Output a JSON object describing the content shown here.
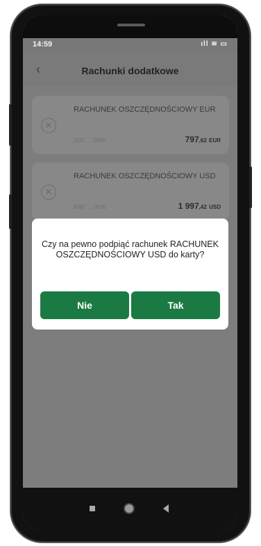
{
  "status_bar": {
    "time": "14:59",
    "icons": "ıll ≋ ▭"
  },
  "header": {
    "title": "Rachunki dodatkowe"
  },
  "accounts": [
    {
      "name": "RACHUNEK OSZCZĘDNOŚCIOWY EUR",
      "number": "1187 ... 0050",
      "amount": "797",
      "amount_minor": ",62",
      "currency": "EUR"
    },
    {
      "name": "RACHUNEK OSZCZĘDNOŚCIOWY USD",
      "number": "8387 ... 0070",
      "amount": "1 997",
      "amount_minor": ",42",
      "currency": "USD"
    }
  ],
  "dialog": {
    "message": "Czy na pewno podpiąć rachunek RACHUNEK OSZCZĘDNOŚCIOWY USD do karty?",
    "no_label": "Nie",
    "yes_label": "Tak"
  },
  "colors": {
    "accent": "#1b7a43"
  },
  "icons": {
    "back": "chevron-left-icon",
    "unlink": "close-circle-icon"
  }
}
